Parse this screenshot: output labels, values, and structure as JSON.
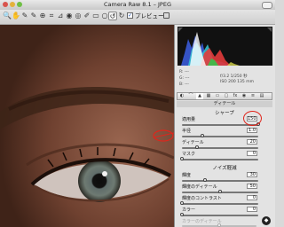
{
  "window": {
    "title": "Camera Raw 8.1 – JPEG",
    "preview_label": "プレビュー",
    "preview_checked": "✓"
  },
  "toolbar_icons": [
    "zoom-icon",
    "hand-icon",
    "white-balance-icon",
    "color-sampler-icon",
    "target-adjust-icon",
    "crop-icon",
    "straighten-icon",
    "spot-removal-icon",
    "red-eye-icon",
    "adjustment-brush-icon",
    "graduated-filter-icon",
    "radial-filter-icon",
    "preferences-icon",
    "rotate-ccw-icon",
    "rotate-cw-icon"
  ],
  "histogram": {
    "colors": [
      "#3a5bd8",
      "#36c7d6",
      "#e23b3b",
      "#ffffff",
      "#35c24a",
      "#d4d44a"
    ]
  },
  "camera_info": {
    "r_label": "R:",
    "g_label": "G:",
    "b_label": "B:",
    "dashes": "---",
    "aperture_shutter": "f/3.2   1/250 秒",
    "iso_focal": "ISO 200   135 mm"
  },
  "panel": {
    "section_title": "ディテール",
    "sharpen_title": "シャープ",
    "noise_title": "ノイズ軽減",
    "sharpen_controls": [
      {
        "label": "適用量",
        "value": "150",
        "fraction": 1.0
      },
      {
        "label": "半径",
        "value": "1.0",
        "fraction": 0.27
      },
      {
        "label": "ディテール",
        "value": "20",
        "fraction": 0.2
      },
      {
        "label": "マスク",
        "value": "0",
        "fraction": 0.0
      }
    ],
    "noise_controls": [
      {
        "label": "輝度",
        "value": "30",
        "fraction": 0.3
      },
      {
        "label": "輝度のディテール",
        "value": "50",
        "fraction": 0.5
      },
      {
        "label": "輝度のコントラスト",
        "value": "0",
        "fraction": 0.0
      },
      {
        "label": "カラー",
        "value": "0",
        "fraction": 0.0
      },
      {
        "label": "カラーのディテール",
        "value": "",
        "fraction": 0.5,
        "disabled": true
      }
    ]
  },
  "annotation_color": "#e0251c"
}
